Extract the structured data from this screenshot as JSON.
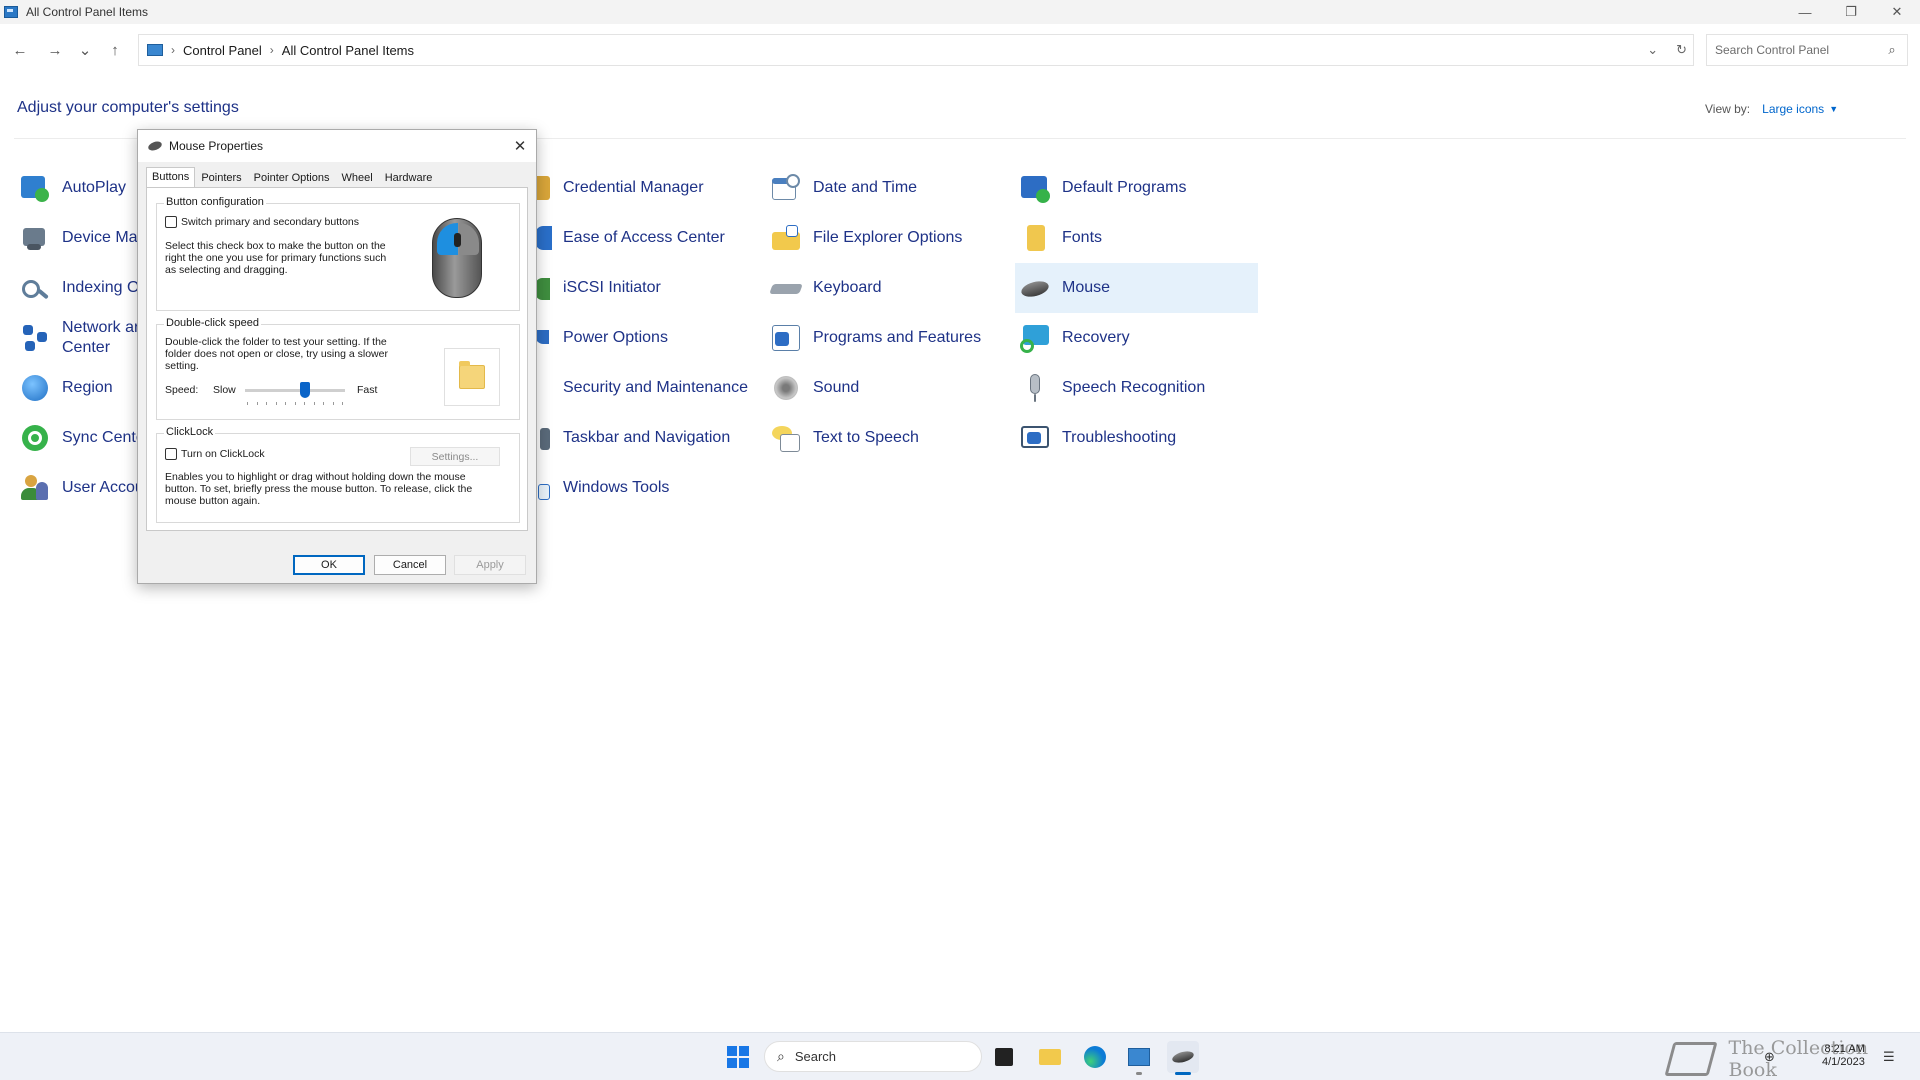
{
  "window": {
    "title": "All Control Panel Items",
    "controls": {
      "minimize": "—",
      "restore": "❐",
      "close": "✕"
    }
  },
  "nav": {
    "back": "←",
    "forward": "→",
    "recent": "⌄",
    "up": "↑"
  },
  "address": {
    "breadcrumbs": [
      "Control Panel",
      "All Control Panel Items"
    ],
    "separator": "›",
    "dropdown": "⌄",
    "refresh": "↻"
  },
  "search": {
    "placeholder": "Search Control Panel",
    "icon": "⌕"
  },
  "header": {
    "title": "Adjust your computer's settings",
    "view_by_label": "View by:",
    "view_by_value": "Large icons",
    "view_by_caret": "▼"
  },
  "items": {
    "col1": [
      "AutoPlay",
      "Device Mar",
      "Indexing O",
      "Network ar",
      "Region",
      "Sync Cente",
      "User Accou"
    ],
    "network_line2": "Center",
    "col2": [
      "Credential Manager",
      "Ease of Access Center",
      "iSCSI Initiator",
      "Power Options",
      "Security and Maintenance",
      "Taskbar and Navigation",
      "Windows Tools"
    ],
    "col3": [
      "Date and Time",
      "File Explorer Options",
      "Keyboard",
      "Programs and Features",
      "Sound",
      "Text to Speech"
    ],
    "col4": [
      "Default Programs",
      "Fonts",
      "Mouse",
      "Recovery",
      "Speech Recognition",
      "Troubleshooting"
    ],
    "selected": "Mouse"
  },
  "dialog": {
    "title": "Mouse Properties",
    "close": "✕",
    "tabs": [
      "Buttons",
      "Pointers",
      "Pointer Options",
      "Wheel",
      "Hardware"
    ],
    "active_tab": "Buttons",
    "button_config": {
      "label": "Button configuration",
      "checkbox_label": "Switch primary and secondary buttons",
      "checked": false,
      "description": "Select this check box to make the button on the right the one you use for primary functions such as selecting and dragging."
    },
    "double_click": {
      "label": "Double-click speed",
      "description": "Double-click the folder to test your setting. If the folder does not open or close, try using a slower setting.",
      "speed_label": "Speed:",
      "slow_label": "Slow",
      "fast_label": "Fast",
      "speed_value": 0.6
    },
    "clicklock": {
      "label": "ClickLock",
      "checkbox_label": "Turn on ClickLock",
      "checked": false,
      "settings_label": "Settings...",
      "description": "Enables you to highlight or drag without holding down the mouse button. To set, briefly press the mouse button. To release, click the mouse button again."
    },
    "buttons": {
      "ok": "OK",
      "cancel": "Cancel",
      "apply": "Apply"
    }
  },
  "taskbar": {
    "search_label": "Search",
    "search_icon": "⌕",
    "watermark": "The Collection Book",
    "time": "8:21 AM",
    "date": "4/1/2023"
  },
  "colors": {
    "link": "#1e3287",
    "accent": "#0067c0",
    "selected_bg": "#e5f1fb"
  }
}
